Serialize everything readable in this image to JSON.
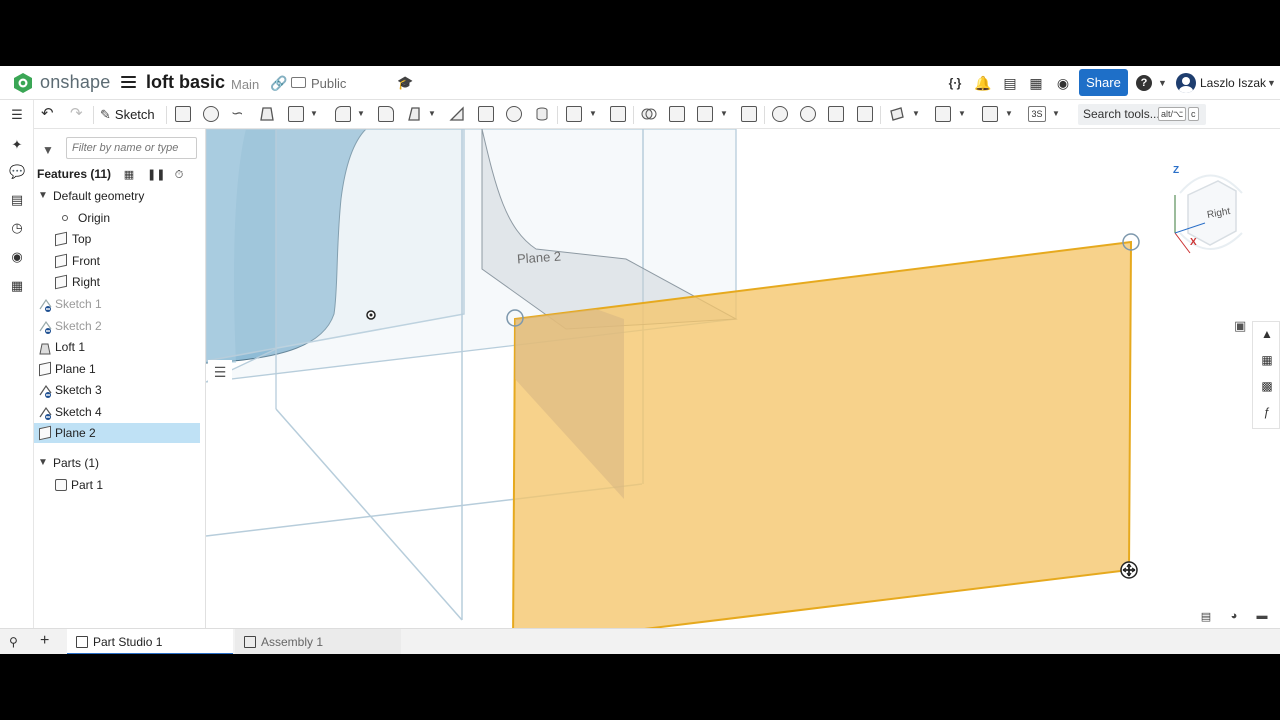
{
  "header": {
    "logo_text": "onshape",
    "doc_title": "loft basic",
    "branch": "Main",
    "visibility": "Public",
    "share_label": "Share",
    "user_name": "Laszlo Iszak",
    "help_label": "?"
  },
  "toolbar": {
    "sketch_label": "Sketch",
    "search_label": "Search tools...",
    "shortcut_1": "alt/⌥",
    "shortcut_2": "c",
    "badge_3s": "3S"
  },
  "panel": {
    "filter_placeholder": "Filter by name or type",
    "features_title": "Features (11)",
    "default_geometry": "Default geometry",
    "items": [
      {
        "label": "Origin",
        "kind": "origin"
      },
      {
        "label": "Top",
        "kind": "plane"
      },
      {
        "label": "Front",
        "kind": "plane"
      },
      {
        "label": "Right",
        "kind": "plane"
      },
      {
        "label": "Sketch 1",
        "kind": "sketch-hidden"
      },
      {
        "label": "Sketch 2",
        "kind": "sketch-hidden"
      },
      {
        "label": "Loft 1",
        "kind": "loft"
      },
      {
        "label": "Plane 1",
        "kind": "plane"
      },
      {
        "label": "Sketch 3",
        "kind": "sketch"
      },
      {
        "label": "Sketch 4",
        "kind": "sketch"
      },
      {
        "label": "Plane 2",
        "kind": "plane-selected"
      }
    ],
    "parts_title": "Parts (1)",
    "part_item": "Part 1"
  },
  "viewport": {
    "plane_label": "Plane 2",
    "cube_face": "Right",
    "axis_z": "Z",
    "axis_x": "X",
    "plane_color": "#f5c56a",
    "plane_edge_color": "#e6a91e",
    "body_color": "#8fbcd6"
  },
  "tabs": {
    "part_studio": "Part Studio 1",
    "assembly": "Assembly 1"
  }
}
